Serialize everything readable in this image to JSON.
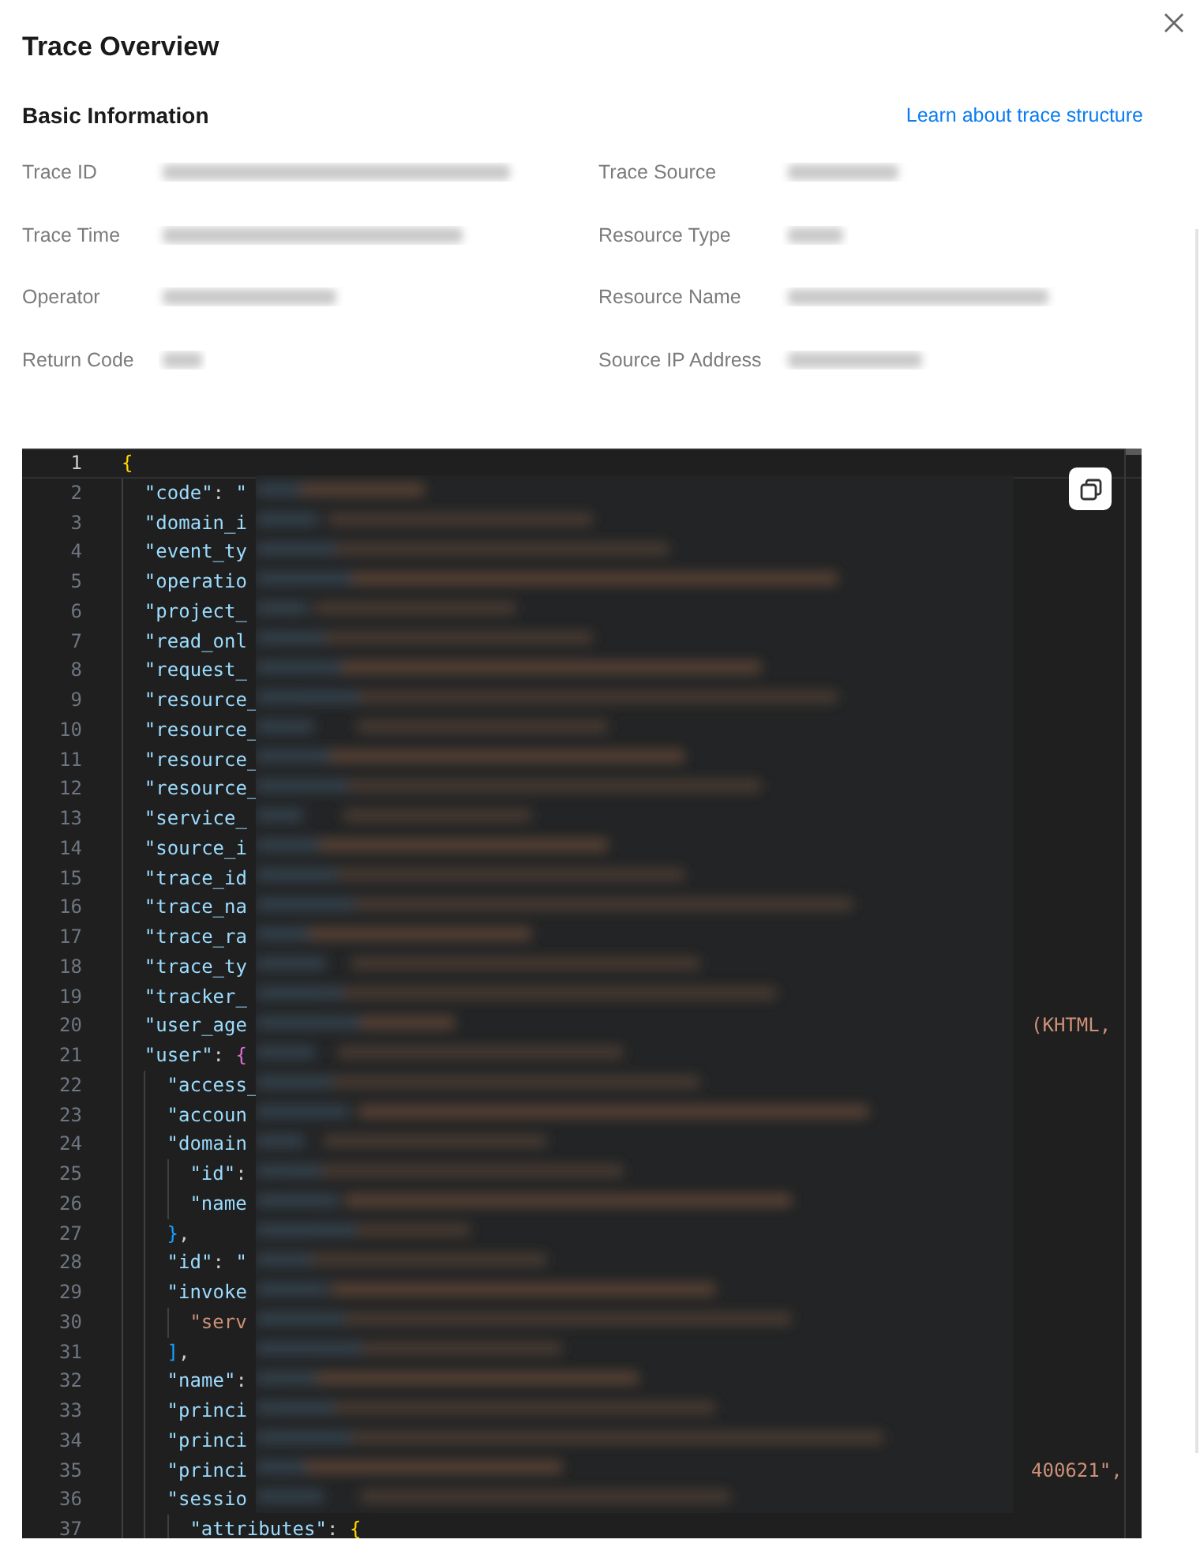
{
  "dialog": {
    "title": "Trace Overview"
  },
  "basic_info": {
    "title": "Basic Information",
    "link": "Learn about trace structure",
    "fields": [
      {
        "label": "Trace ID"
      },
      {
        "label": "Trace Source"
      },
      {
        "label": "Trace Time"
      },
      {
        "label": "Resource Type"
      },
      {
        "label": "Operator"
      },
      {
        "label": "Resource Name"
      },
      {
        "label": "Return Code"
      },
      {
        "label": "Source IP Address"
      }
    ]
  },
  "code_view": {
    "lines": [
      {
        "number": "1",
        "text": "{",
        "active": true,
        "children": [
          {
            "number": "2",
            "text": "\"code\": \"",
            "active": false
          },
          {
            "number": "3",
            "text": "\"domain_i",
            "active": false
          },
          {
            "number": "4",
            "text": "\"event_ty",
            "active": false
          },
          {
            "number": "5",
            "text": "\"operatio",
            "active": false
          },
          {
            "number": "6",
            "text": "\"project_",
            "active": false
          },
          {
            "number": "7",
            "text": "\"read_onl",
            "active": false
          },
          {
            "number": "8",
            "text": "\"request_",
            "active": false
          },
          {
            "number": "9",
            "text": "\"resource_",
            "active": false
          },
          {
            "number": "10",
            "text": "\"resource_",
            "active": false
          },
          {
            "number": "11",
            "text": "\"resource_",
            "active": false
          },
          {
            "number": "12",
            "text": "\"resource_",
            "active": false
          },
          {
            "number": "13",
            "text": "\"service_",
            "active": false
          },
          {
            "number": "14",
            "text": "\"source_i",
            "active": false
          },
          {
            "number": "15",
            "text": "\"trace_id",
            "active": false
          },
          {
            "number": "16",
            "text": "\"trace_na",
            "active": false
          },
          {
            "number": "17",
            "text": "\"trace_ra",
            "active": false
          },
          {
            "number": "18",
            "text": "\"trace_ty",
            "active": false
          },
          {
            "number": "19",
            "text": "\"tracker_",
            "active": false
          },
          {
            "number": "20",
            "text": "\"user_age",
            "active": false,
            "suffix": "(KHTML,"
          },
          {
            "number": "21",
            "text": "\"user\": {",
            "active": false,
            "children": [
              {
                "number": "22",
                "text": "\"access_",
                "active": false
              },
              {
                "number": "23",
                "text": "\"accoun",
                "active": false
              },
              {
                "number": "24",
                "text": "\"domain",
                "active": false,
                "children": [
                  {
                    "number": "25",
                    "text": "\"id\":",
                    "active": false
                  },
                  {
                    "number": "26",
                    "text": "\"name",
                    "active": false
                  }
                ]
              },
              {
                "number": "27",
                "text": "},",
                "active": false
              },
              {
                "number": "28",
                "text": "\"id\": \"",
                "active": false
              },
              {
                "number": "29",
                "text": "\"invoke",
                "active": false,
                "children": [
                  {
                    "number": "30",
                    "text": "\"serv",
                    "kind": "string",
                    "active": false
                  }
                ]
              },
              {
                "number": "31",
                "text": "],",
                "active": false
              },
              {
                "number": "32",
                "text": "\"name\":",
                "active": false
              },
              {
                "number": "33",
                "text": "\"princi",
                "active": false
              },
              {
                "number": "34",
                "text": "\"princi",
                "active": false
              },
              {
                "number": "35",
                "text": "\"princi",
                "active": false,
                "suffix": "400621\","
              },
              {
                "number": "36",
                "text": "\"sessio",
                "active": false,
                "children": [
                  {
                    "number": "37",
                    "text": "\"attributes\": {",
                    "active": false
                  }
                ]
              }
            ]
          }
        ]
      }
    ]
  }
}
